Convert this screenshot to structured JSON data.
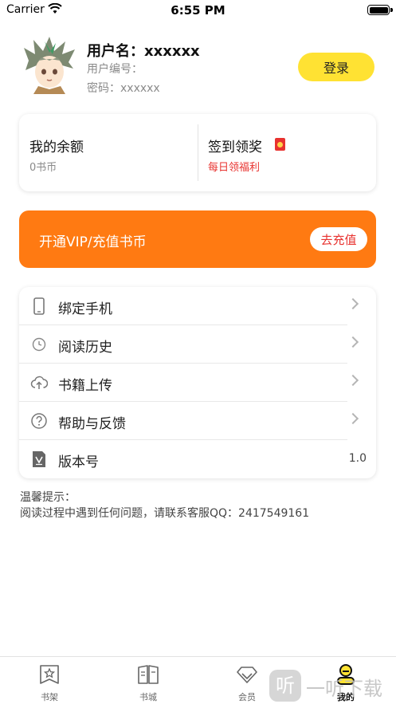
{
  "status_bar": {
    "carrier": "Carrier",
    "time": "6:55 PM"
  },
  "profile": {
    "username": "用户名：xxxxxx",
    "user_id": "用户编号：",
    "password": "密码：xxxxxx",
    "login_label": "登录"
  },
  "balance": {
    "title": "我的余额",
    "value": "0书币"
  },
  "signin": {
    "title": "签到领奖",
    "subtitle": "每日领福利"
  },
  "vip": {
    "text": "开通VIP/充值书币",
    "button": "去充值"
  },
  "menu": {
    "items": [
      {
        "label": "绑定手机",
        "icon": "phone-icon"
      },
      {
        "label": "阅读历史",
        "icon": "clock-icon"
      },
      {
        "label": "书籍上传",
        "icon": "cloud-upload-icon"
      },
      {
        "label": "帮助与反馈",
        "icon": "help-icon"
      },
      {
        "label": "版本号",
        "icon": "version-icon",
        "value": "1.0"
      }
    ]
  },
  "tip": {
    "title": "温馨提示：",
    "body": "阅读过程中遇到任何问题，请联系客服QQ：2417549161"
  },
  "tabs": [
    {
      "label": "书架",
      "icon": "bookshelf-icon"
    },
    {
      "label": "书城",
      "icon": "book-icon"
    },
    {
      "label": "会员",
      "icon": "diamond-icon"
    },
    {
      "label": "我的",
      "icon": "profile-icon",
      "active": true
    }
  ],
  "watermark": {
    "logo": "听",
    "text": "一听下载"
  },
  "colors": {
    "accent_yellow": "#ffe233",
    "vip_orange": "#ff7a12",
    "red": "#e8322f"
  }
}
